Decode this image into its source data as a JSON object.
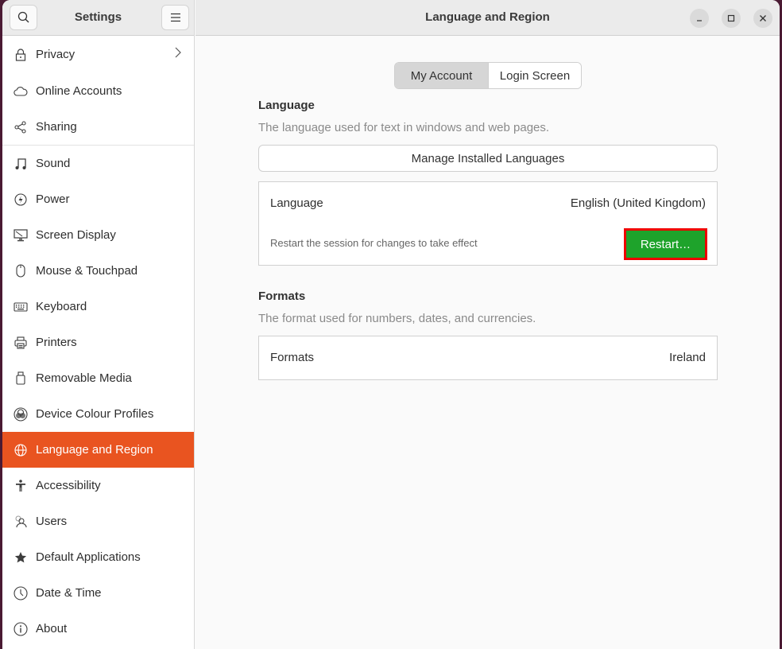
{
  "sidebar": {
    "title": "Settings",
    "search_icon": "search-icon",
    "menu_icon": "hamburger-menu-icon",
    "items": [
      {
        "label": "Privacy",
        "icon": "lock-icon",
        "has_chevron": true
      },
      {
        "label": "Online Accounts",
        "icon": "cloud-icon"
      },
      {
        "label": "Sharing",
        "icon": "share-icon"
      },
      {
        "label": "Sound",
        "icon": "music-note-icon"
      },
      {
        "label": "Power",
        "icon": "power-icon"
      },
      {
        "label": "Screen Display",
        "icon": "display-icon"
      },
      {
        "label": "Mouse & Touchpad",
        "icon": "mouse-icon"
      },
      {
        "label": "Keyboard",
        "icon": "keyboard-icon"
      },
      {
        "label": "Printers",
        "icon": "printer-icon"
      },
      {
        "label": "Removable Media",
        "icon": "usb-drive-icon"
      },
      {
        "label": "Device Colour Profiles",
        "icon": "color-profile-icon"
      },
      {
        "label": "Language and Region",
        "icon": "globe-icon",
        "active": true
      },
      {
        "label": "Accessibility",
        "icon": "accessibility-icon"
      },
      {
        "label": "Users",
        "icon": "users-icon"
      },
      {
        "label": "Default Applications",
        "icon": "star-icon"
      },
      {
        "label": "Date & Time",
        "icon": "clock-icon"
      },
      {
        "label": "About",
        "icon": "info-icon"
      }
    ]
  },
  "header": {
    "title": "Language and Region",
    "window_controls": [
      "minimize",
      "maximize",
      "close"
    ]
  },
  "tabs": [
    {
      "label": "My Account",
      "selected": true
    },
    {
      "label": "Login Screen",
      "selected": false
    }
  ],
  "language_section": {
    "title": "Language",
    "description": "The language used for text in windows and web pages.",
    "manage_button": "Manage Installed Languages",
    "row_label": "Language",
    "row_value": "English (United Kingdom)",
    "restart_hint": "Restart the session for changes to take effect",
    "restart_button": "Restart…"
  },
  "formats_section": {
    "title": "Formats",
    "description": "The format used for numbers, dates, and currencies.",
    "row_label": "Formats",
    "row_value": "Ireland"
  },
  "colors": {
    "accent": "#e95420",
    "restart_green": "#1ea32b",
    "highlight_red": "#ee0000"
  }
}
